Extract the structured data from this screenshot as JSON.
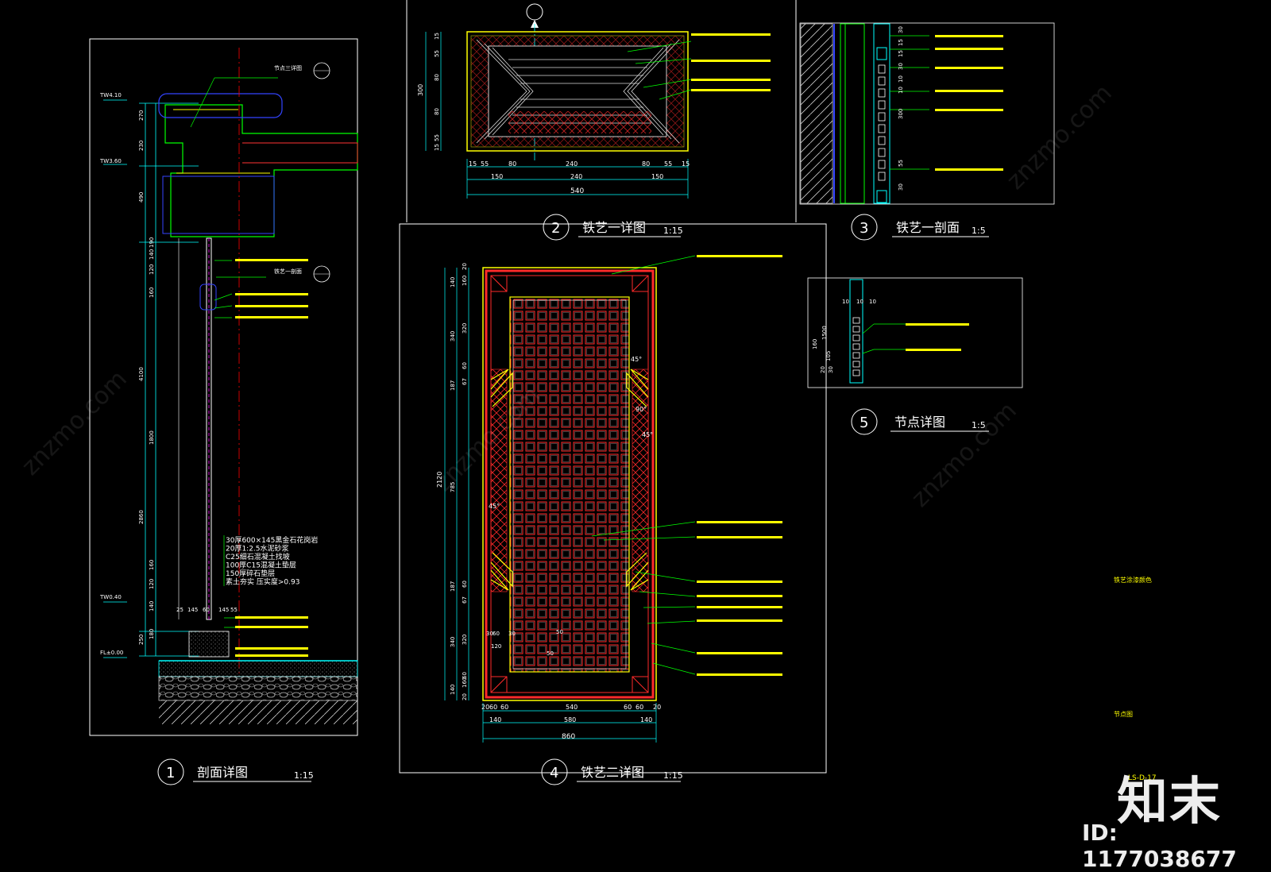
{
  "panels": {
    "p1": {
      "num": "1",
      "title": "剖面详图",
      "scale": "1:15"
    },
    "p2": {
      "num": "2",
      "title": "铁艺一详图",
      "scale": "1:15"
    },
    "p3": {
      "num": "3",
      "title": "铁艺一剖面",
      "scale": "1:5"
    },
    "p4": {
      "num": "4",
      "title": "铁艺二详图",
      "scale": "1:15"
    },
    "p5": {
      "num": "5",
      "title": "节点详图",
      "scale": "1:5"
    }
  },
  "section": {
    "elev_1": "TW4.10",
    "elev_2": "TW3.60",
    "elev_3": "TW0.40",
    "elev_4": "FL±0.00",
    "ref_top": "节点三详图",
    "ref_mid": "铁艺一剖面",
    "dims_outer": [
      "270",
      "230",
      "490",
      "4100",
      "2860",
      "250"
    ],
    "dims_inner": [
      "190",
      "140",
      "120",
      "160",
      "1800",
      "160",
      "120",
      "140",
      "180"
    ],
    "bottom_dims": [
      "25",
      "145",
      "60",
      "145",
      "55"
    ],
    "layers": [
      "30厚600×145黑金石花岗岩",
      "20厚1:2.5水泥砂浆",
      "C25细石混凝土找坡",
      "100厚C15混凝土垫层",
      "150厚碎石垫层",
      "素土夯实 压实度>0.93"
    ]
  },
  "detail2": {
    "dims_bottom_1": [
      "15",
      "55",
      "80",
      "240",
      "80",
      "55",
      "15"
    ],
    "dims_bottom_2": [
      "150",
      "240",
      "150"
    ],
    "dims_total": "540",
    "dims_left": [
      "15",
      "55",
      "80",
      "80",
      "55",
      "15"
    ],
    "dim_height": "300"
  },
  "detail3": {
    "dims": [
      "30",
      "15",
      "15",
      "30",
      "10",
      "10",
      "300",
      "55",
      "30"
    ]
  },
  "detail4": {
    "dims_bottom": [
      "20",
      "60",
      "60",
      "540",
      "60",
      "60",
      "20"
    ],
    "dims_bottom_2": [
      "140",
      "580",
      "140"
    ],
    "dims_total": "860",
    "dims_left": [
      "140",
      "340",
      "187",
      "785",
      "187",
      "340",
      "140"
    ],
    "dims_left_2": [
      "20",
      "160",
      "320",
      "60",
      "67",
      "60",
      "67",
      "320",
      "60",
      "160",
      "20"
    ],
    "dim_height": "2120",
    "angles": [
      "45°",
      "90°",
      "45°",
      "45°"
    ],
    "dims_cell": [
      "50",
      "50",
      "30",
      "60",
      "30",
      "120"
    ]
  },
  "detail5": {
    "dims": [
      "10",
      "10",
      "10",
      "160",
      "1500",
      "105",
      "20",
      "30"
    ]
  },
  "notes": {
    "legend_1": "铁艺涂漆颜色",
    "legend_2": "节点图"
  },
  "watermark": {
    "brand": "知末",
    "id": "ID: 1177038677",
    "site": "znzmo.com",
    "sheet": "LS-D-17"
  },
  "colors": {
    "background": "#000000",
    "cyan": "#00ffff",
    "green": "#00ff00",
    "yellow": "#ffff00",
    "red": "#ff0000",
    "white": "#ffffff",
    "blue": "#3333ff",
    "magenta": "#ff00ff"
  }
}
